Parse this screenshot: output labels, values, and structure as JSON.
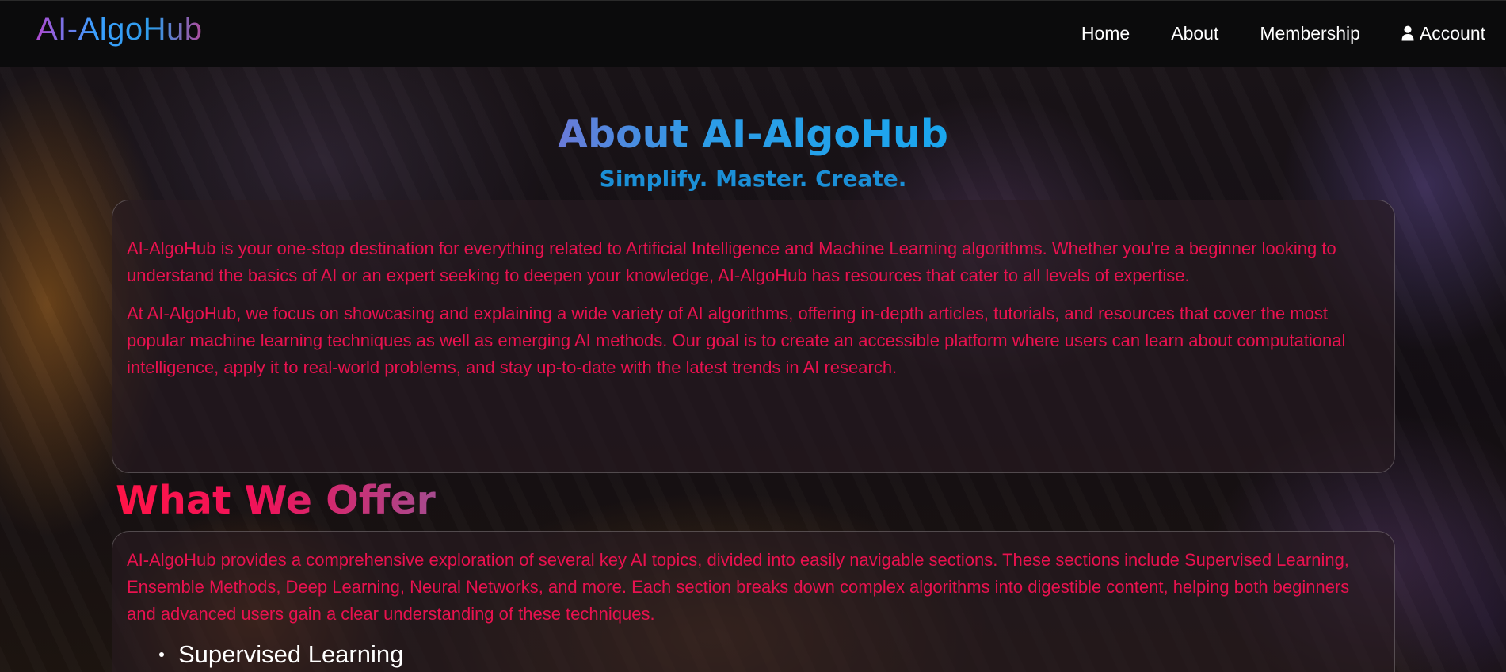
{
  "brand": {
    "name": "AI-AlgoHub"
  },
  "nav": {
    "items": [
      {
        "label": "Home"
      },
      {
        "label": "About"
      },
      {
        "label": "Membership"
      },
      {
        "label": "Account",
        "icon": "user-icon"
      }
    ]
  },
  "hero": {
    "title": "About AI-AlgoHub",
    "subtitle": "Simplify. Master. Create."
  },
  "about": {
    "paragraphs": [
      "AI-AlgoHub is your one-stop destination for everything related to Artificial Intelligence and Machine Learning algorithms. Whether you're a beginner looking to understand the basics of AI or an expert seeking to deepen your knowledge, AI-AlgoHub has resources that cater to all levels of expertise.",
      "At AI-AlgoHub, we focus on showcasing and explaining a wide variety of AI algorithms, offering in-depth articles, tutorials, and resources that cover the most popular machine learning techniques as well as emerging AI methods. Our goal is to create an accessible platform where users can learn about computational intelligence, apply it to real-world problems, and stay up-to-date with the latest trends in AI research."
    ]
  },
  "offer": {
    "title": "What We Offer",
    "intro": "AI-AlgoHub provides a comprehensive exploration of several key AI topics, divided into easily navigable sections. These sections include Supervised Learning, Ensemble Methods, Deep Learning, Neural Networks, and more. Each section breaks down complex algorithms into digestible content, helping both beginners and advanced users gain a clear understanding of these techniques.",
    "topics": [
      {
        "label": "Supervised Learning"
      }
    ]
  },
  "colors": {
    "paragraph_text": "#e8124f",
    "subtitle": "#1b8fd6",
    "nav_background": "#0b0b0c"
  }
}
